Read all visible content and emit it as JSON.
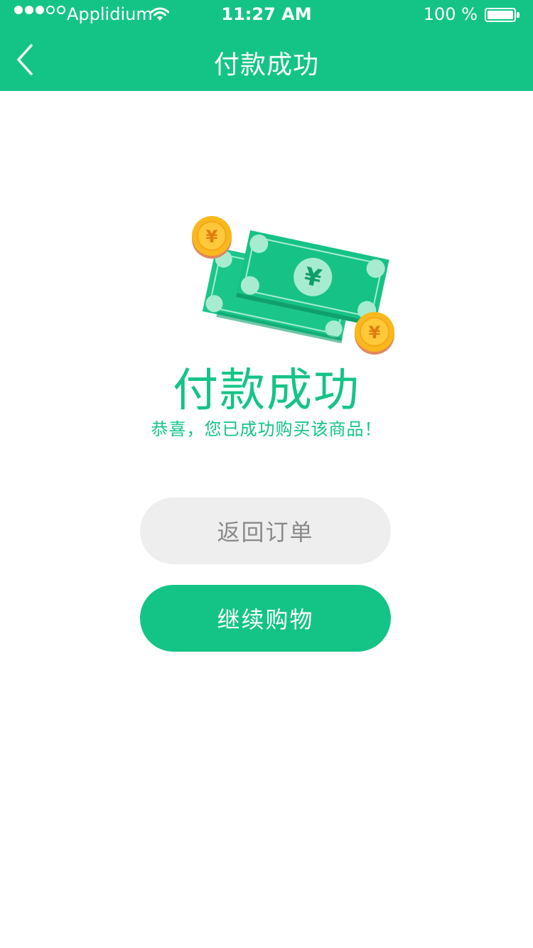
{
  "statusbar": {
    "carrier": "Applidium",
    "time": "11:27 AM",
    "battery": "100 %"
  },
  "nav": {
    "title": "付款成功",
    "back_icon": "chevron-left-icon"
  },
  "illustration": {
    "currency_symbol": "¥",
    "icons": [
      "banknote-icon",
      "coin-icon"
    ]
  },
  "result": {
    "title": "付款成功",
    "subtitle": "恭喜，您已成功购买该商品！"
  },
  "actions": {
    "return_label": "返回订单",
    "continue_label": "继续购物"
  },
  "colors": {
    "brand": "#14c486",
    "button_secondary_bg": "#eeeeee",
    "button_secondary_text": "#8a8a8a",
    "coin": "#f9b81c"
  }
}
